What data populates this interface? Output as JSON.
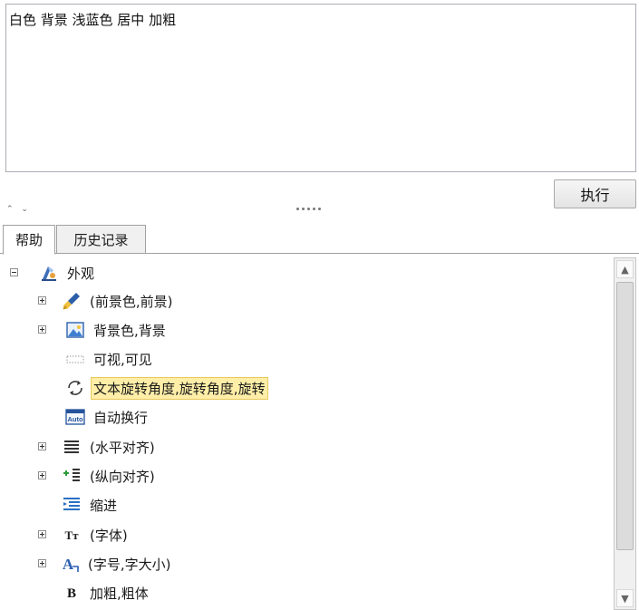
{
  "command": {
    "text": "白色 背景 浅蓝色 居中 加粗",
    "run_label": "执行"
  },
  "splitter": {
    "arrows": "⌃ ⌄"
  },
  "tabs": [
    {
      "label": "帮助",
      "active": true
    },
    {
      "label": "历史记录",
      "active": false
    }
  ],
  "tree": {
    "root": {
      "label": "外观",
      "icon": "appearance-icon",
      "expanded": true
    },
    "items": [
      {
        "label": "(前景色,前景)",
        "icon": "brush-icon",
        "expander": "plus"
      },
      {
        "label": "背景色,背景",
        "icon": "picture-icon",
        "expander": "plus"
      },
      {
        "label": "可视,可见",
        "icon": "dotted-rect-icon",
        "expander": "none"
      },
      {
        "label": "文本旋转角度,旋转角度,旋转",
        "icon": "rotate-icon",
        "expander": "none",
        "selected": true
      },
      {
        "label": "自动换行",
        "icon": "auto-wrap-icon",
        "expander": "none",
        "icon_text": "Auto"
      },
      {
        "label": "(水平对齐)",
        "icon": "align-horizontal-icon",
        "expander": "plus"
      },
      {
        "label": "(纵向对齐)",
        "icon": "align-vertical-icon",
        "expander": "plus"
      },
      {
        "label": "缩进",
        "icon": "indent-icon",
        "expander": "none"
      },
      {
        "label": "(字体)",
        "icon": "font-icon",
        "expander": "plus",
        "icon_text": "Tт"
      },
      {
        "label": "(字号,字大小)",
        "icon": "font-size-icon",
        "expander": "plus",
        "icon_text": "A"
      },
      {
        "label": "加粗,粗体",
        "icon": "bold-icon",
        "expander": "none",
        "icon_text": "B"
      }
    ]
  },
  "colors": {
    "selection_bg": "#ffeea8",
    "selection_border": "#e8c95d",
    "border": "#abadb3"
  }
}
